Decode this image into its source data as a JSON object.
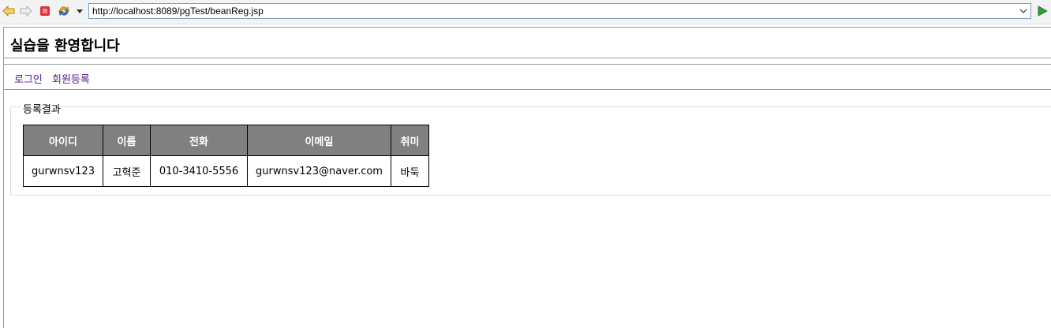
{
  "browser": {
    "url": "http://localhost:8089/pgTest/beanReg.jsp"
  },
  "page": {
    "title": "실습을 환영합니다",
    "nav": {
      "login": "로그인",
      "register": "회원등록"
    },
    "fieldset_legend": "등록결과",
    "table": {
      "headers": [
        "아이디",
        "이름",
        "전화",
        "이메일",
        "취미"
      ],
      "rows": [
        [
          "gurwnsv123",
          "고혁준",
          "010-3410-5556",
          "gurwnsv123@naver.com",
          "바둑"
        ]
      ]
    }
  },
  "icons": {
    "back": "back-arrow-icon",
    "forward": "forward-arrow-icon",
    "stop": "stop-icon",
    "refresh": "refresh-icon",
    "dropdown": "dropdown-triangle-icon",
    "url_chevron": "chevron-down-icon",
    "go": "go-play-icon"
  },
  "colors": {
    "header_bg": "#808080",
    "link": "#551a8b",
    "stop": "#e0303a",
    "go": "#2e9e3a"
  }
}
